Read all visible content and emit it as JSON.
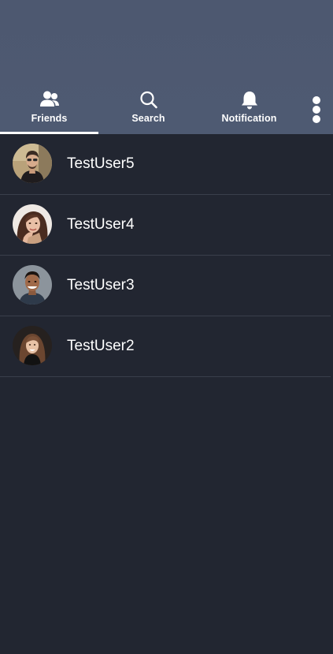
{
  "tabs": [
    {
      "label": "Friends",
      "icon": "friends-icon",
      "active": true
    },
    {
      "label": "Search",
      "icon": "search-icon",
      "active": false
    },
    {
      "label": "Notification",
      "icon": "bell-icon",
      "active": false
    }
  ],
  "more_menu": {
    "icon": "more-vertical-icon"
  },
  "friends": [
    {
      "name": "TestUser5"
    },
    {
      "name": "TestUser4"
    },
    {
      "name": "TestUser3"
    },
    {
      "name": "TestUser2"
    }
  ],
  "colors": {
    "header_bg": "#4e5a72",
    "content_bg": "#222631",
    "divider": "#3a3f4b",
    "text": "#ffffff"
  }
}
